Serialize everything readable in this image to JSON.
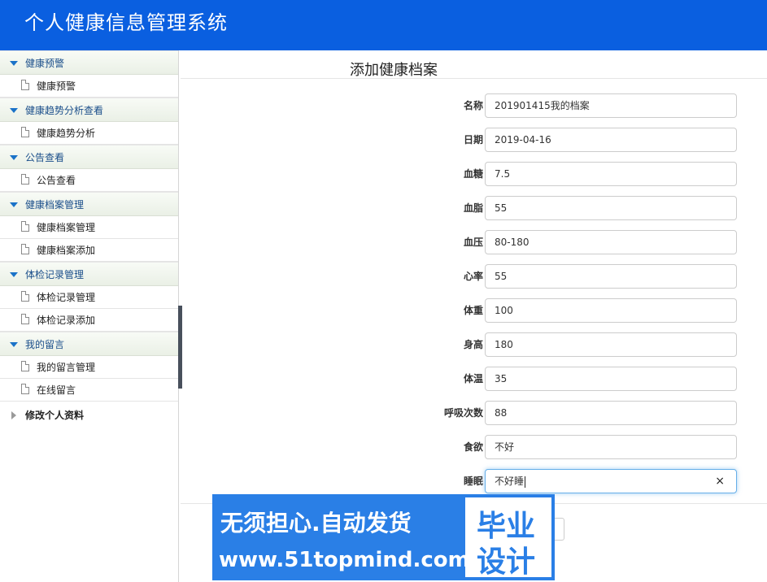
{
  "header": {
    "title": "个人健康信息管理系统"
  },
  "sidebar": {
    "groups": [
      {
        "label": "健康预警",
        "items": [
          "健康预警"
        ]
      },
      {
        "label": "健康趋势分析查看",
        "items": [
          "健康趋势分析"
        ]
      },
      {
        "label": "公告查看",
        "items": [
          "公告查看"
        ]
      },
      {
        "label": "健康档案管理",
        "items": [
          "健康档案管理",
          "健康档案添加"
        ]
      },
      {
        "label": "体检记录管理",
        "items": [
          "体检记录管理",
          "体检记录添加"
        ]
      },
      {
        "label": "我的留言",
        "items": [
          "我的留言管理",
          "在线留言"
        ]
      }
    ],
    "extra_item": "修改个人资料"
  },
  "main": {
    "title": "添加健康档案",
    "fields": [
      {
        "label": "名称",
        "value": "201901415我的档案"
      },
      {
        "label": "日期",
        "value": "2019-04-16"
      },
      {
        "label": "血糖",
        "value": "7.5"
      },
      {
        "label": "血脂",
        "value": "55"
      },
      {
        "label": "血压",
        "value": "80-180"
      },
      {
        "label": "心率",
        "value": "55"
      },
      {
        "label": "体重",
        "value": "100"
      },
      {
        "label": "身高",
        "value": "180"
      },
      {
        "label": "体温",
        "value": "35"
      },
      {
        "label": "呼吸次数",
        "value": "88"
      },
      {
        "label": "食欲",
        "value": "不好"
      },
      {
        "label": "睡眠",
        "value": "不好睡"
      }
    ],
    "clear_icon": "×"
  },
  "watermark": {
    "line1": "无须担心.自动发货",
    "line2": "www.51topmind.com",
    "badge_line1": "毕业",
    "badge_line2": "设计"
  },
  "colors": {
    "header": "#0a5fe0",
    "accent": "#1a72c8",
    "watermark": "#2a7fe6"
  }
}
